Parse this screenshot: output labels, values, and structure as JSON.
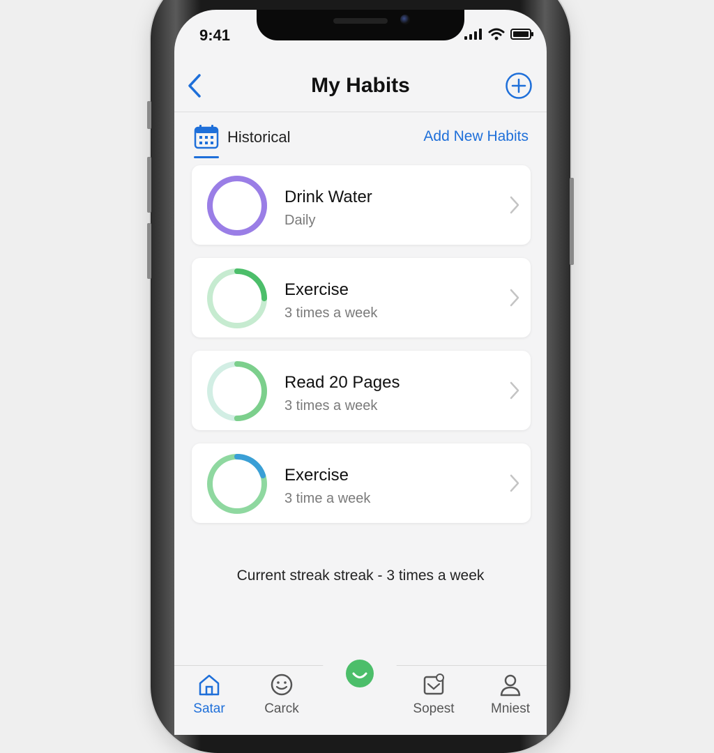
{
  "status_bar": {
    "time": "9:41"
  },
  "header": {
    "title": "My Habits"
  },
  "sub_header": {
    "historical_label": "Historical",
    "add_new_label": "Add New Habits"
  },
  "habits": [
    {
      "name": "Drink Water",
      "frequency": "Daily",
      "progress": 1.0,
      "track_color": "#c9b8f0",
      "fill_color": "#9a7ee6"
    },
    {
      "name": "Exercise",
      "frequency": "3 times a week",
      "progress": 0.25,
      "track_color": "#c6ebd0",
      "fill_color": "#4cbe6a"
    },
    {
      "name": "Read 20 Pages",
      "frequency": "3 times a week",
      "progress": 0.5,
      "track_color": "#d2eee4",
      "fill_color": "#7ccf8c"
    },
    {
      "name": "Exercise",
      "frequency": "3 time a week",
      "progress": 0.2,
      "track_color": "#8fd8a0",
      "fill_color": "#3a9fd6"
    }
  ],
  "streak_text": "Current streak streak - 3 times a week",
  "tab_bar": {
    "items": [
      {
        "label": "Satar",
        "icon": "home-icon",
        "active": true
      },
      {
        "label": "Carck",
        "icon": "smiley-icon",
        "active": false
      },
      {
        "label": "Sopest",
        "icon": "mail-icon",
        "active": false
      },
      {
        "label": "Mniest",
        "icon": "profile-icon",
        "active": false
      }
    ],
    "center_icon": "smile-icon"
  },
  "colors": {
    "accent": "#1e6fd9",
    "center_button": "#4cbe6a"
  }
}
